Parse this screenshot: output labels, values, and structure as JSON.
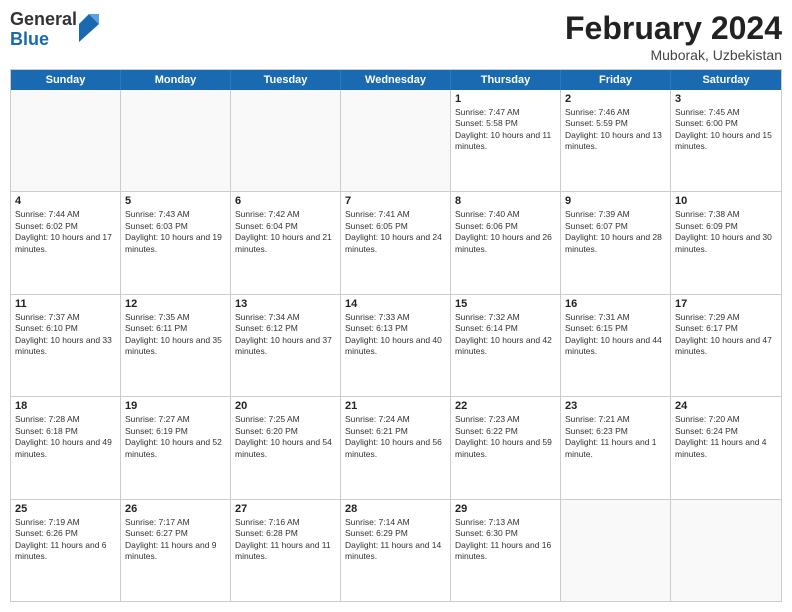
{
  "logo": {
    "general": "General",
    "blue": "Blue"
  },
  "header": {
    "title": "February 2024",
    "subtitle": "Muborak, Uzbekistan"
  },
  "weekdays": [
    "Sunday",
    "Monday",
    "Tuesday",
    "Wednesday",
    "Thursday",
    "Friday",
    "Saturday"
  ],
  "rows": [
    [
      {
        "day": "",
        "info": ""
      },
      {
        "day": "",
        "info": ""
      },
      {
        "day": "",
        "info": ""
      },
      {
        "day": "",
        "info": ""
      },
      {
        "day": "1",
        "info": "Sunrise: 7:47 AM\nSunset: 5:58 PM\nDaylight: 10 hours and 11 minutes."
      },
      {
        "day": "2",
        "info": "Sunrise: 7:46 AM\nSunset: 5:59 PM\nDaylight: 10 hours and 13 minutes."
      },
      {
        "day": "3",
        "info": "Sunrise: 7:45 AM\nSunset: 6:00 PM\nDaylight: 10 hours and 15 minutes."
      }
    ],
    [
      {
        "day": "4",
        "info": "Sunrise: 7:44 AM\nSunset: 6:02 PM\nDaylight: 10 hours and 17 minutes."
      },
      {
        "day": "5",
        "info": "Sunrise: 7:43 AM\nSunset: 6:03 PM\nDaylight: 10 hours and 19 minutes."
      },
      {
        "day": "6",
        "info": "Sunrise: 7:42 AM\nSunset: 6:04 PM\nDaylight: 10 hours and 21 minutes."
      },
      {
        "day": "7",
        "info": "Sunrise: 7:41 AM\nSunset: 6:05 PM\nDaylight: 10 hours and 24 minutes."
      },
      {
        "day": "8",
        "info": "Sunrise: 7:40 AM\nSunset: 6:06 PM\nDaylight: 10 hours and 26 minutes."
      },
      {
        "day": "9",
        "info": "Sunrise: 7:39 AM\nSunset: 6:07 PM\nDaylight: 10 hours and 28 minutes."
      },
      {
        "day": "10",
        "info": "Sunrise: 7:38 AM\nSunset: 6:09 PM\nDaylight: 10 hours and 30 minutes."
      }
    ],
    [
      {
        "day": "11",
        "info": "Sunrise: 7:37 AM\nSunset: 6:10 PM\nDaylight: 10 hours and 33 minutes."
      },
      {
        "day": "12",
        "info": "Sunrise: 7:35 AM\nSunset: 6:11 PM\nDaylight: 10 hours and 35 minutes."
      },
      {
        "day": "13",
        "info": "Sunrise: 7:34 AM\nSunset: 6:12 PM\nDaylight: 10 hours and 37 minutes."
      },
      {
        "day": "14",
        "info": "Sunrise: 7:33 AM\nSunset: 6:13 PM\nDaylight: 10 hours and 40 minutes."
      },
      {
        "day": "15",
        "info": "Sunrise: 7:32 AM\nSunset: 6:14 PM\nDaylight: 10 hours and 42 minutes."
      },
      {
        "day": "16",
        "info": "Sunrise: 7:31 AM\nSunset: 6:15 PM\nDaylight: 10 hours and 44 minutes."
      },
      {
        "day": "17",
        "info": "Sunrise: 7:29 AM\nSunset: 6:17 PM\nDaylight: 10 hours and 47 minutes."
      }
    ],
    [
      {
        "day": "18",
        "info": "Sunrise: 7:28 AM\nSunset: 6:18 PM\nDaylight: 10 hours and 49 minutes."
      },
      {
        "day": "19",
        "info": "Sunrise: 7:27 AM\nSunset: 6:19 PM\nDaylight: 10 hours and 52 minutes."
      },
      {
        "day": "20",
        "info": "Sunrise: 7:25 AM\nSunset: 6:20 PM\nDaylight: 10 hours and 54 minutes."
      },
      {
        "day": "21",
        "info": "Sunrise: 7:24 AM\nSunset: 6:21 PM\nDaylight: 10 hours and 56 minutes."
      },
      {
        "day": "22",
        "info": "Sunrise: 7:23 AM\nSunset: 6:22 PM\nDaylight: 10 hours and 59 minutes."
      },
      {
        "day": "23",
        "info": "Sunrise: 7:21 AM\nSunset: 6:23 PM\nDaylight: 11 hours and 1 minute."
      },
      {
        "day": "24",
        "info": "Sunrise: 7:20 AM\nSunset: 6:24 PM\nDaylight: 11 hours and 4 minutes."
      }
    ],
    [
      {
        "day": "25",
        "info": "Sunrise: 7:19 AM\nSunset: 6:26 PM\nDaylight: 11 hours and 6 minutes."
      },
      {
        "day": "26",
        "info": "Sunrise: 7:17 AM\nSunset: 6:27 PM\nDaylight: 11 hours and 9 minutes."
      },
      {
        "day": "27",
        "info": "Sunrise: 7:16 AM\nSunset: 6:28 PM\nDaylight: 11 hours and 11 minutes."
      },
      {
        "day": "28",
        "info": "Sunrise: 7:14 AM\nSunset: 6:29 PM\nDaylight: 11 hours and 14 minutes."
      },
      {
        "day": "29",
        "info": "Sunrise: 7:13 AM\nSunset: 6:30 PM\nDaylight: 11 hours and 16 minutes."
      },
      {
        "day": "",
        "info": ""
      },
      {
        "day": "",
        "info": ""
      }
    ]
  ]
}
